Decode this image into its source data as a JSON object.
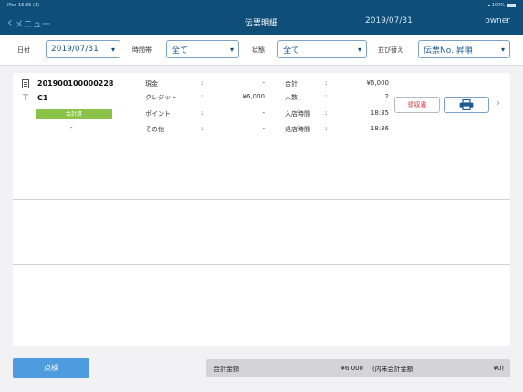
{
  "status_bar": {
    "left": "iPad 16:35 (1)",
    "right": "▴ 100%"
  },
  "nav": {
    "back_label": "メニュー",
    "title": "伝票明細",
    "date": "2019/07/31",
    "user": "owner"
  },
  "filters": {
    "date_label": "日付",
    "date_value": "2019/07/31",
    "time_label": "時間帯",
    "time_value": "全て",
    "status_label": "状態",
    "status_value": "全て",
    "sort_label": "並び替え",
    "sort_value": "伝票No. 昇順"
  },
  "slip": {
    "number": "201900100000228",
    "table": "C1",
    "status_badge": "会計済",
    "sub": "-",
    "payments": [
      {
        "label": "現金",
        "colon": ":",
        "value": "-"
      },
      {
        "label": "クレジット",
        "colon": ":",
        "value": "¥6,000"
      },
      {
        "label": "ポイント",
        "colon": ":",
        "value": "-"
      },
      {
        "label": "その他",
        "colon": ":",
        "value": "-"
      }
    ],
    "info": [
      {
        "label": "合計",
        "colon": ":",
        "value": "¥6,000"
      },
      {
        "label": "人数",
        "colon": ":",
        "value": "2"
      },
      {
        "label": "入店時間",
        "colon": ":",
        "value": "18:35"
      },
      {
        "label": "退店時間",
        "colon": ":",
        "value": "18:36"
      }
    ],
    "receipt_button": "領収書",
    "print_icon": "printer-icon"
  },
  "footer": {
    "check_button": "点検",
    "total_label": "合計金額",
    "total_value": "¥6,000",
    "tax_label": "(内未会計金額",
    "tax_value": "¥0)"
  },
  "colors": {
    "nav_bg": "#0e4e78",
    "accent": "#1a5c93",
    "paid_badge": "#8bc34a",
    "receipt_text": "#d0303a",
    "check_button": "#4f9be0"
  }
}
